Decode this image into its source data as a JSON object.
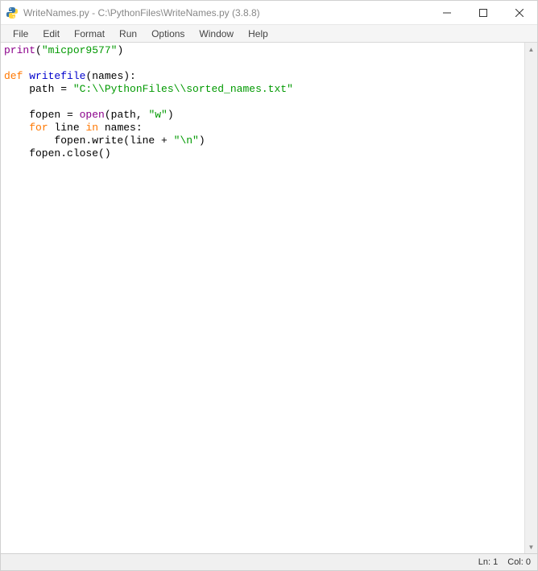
{
  "window": {
    "title": "WriteNames.py - C:\\PythonFiles\\WriteNames.py (3.8.8)"
  },
  "menu": {
    "items": [
      "File",
      "Edit",
      "Format",
      "Run",
      "Options",
      "Window",
      "Help"
    ]
  },
  "code": {
    "line1_print": "print",
    "line1_paren_open": "(",
    "line1_str": "\"micpor9577\"",
    "line1_paren_close": ")",
    "line3_def": "def",
    "line3_space": " ",
    "line3_fn": "writefile",
    "line3_params": "(names):",
    "line4_indent": "    path = ",
    "line4_str": "\"C:\\\\PythonFiles\\\\sorted_names.txt\"",
    "line6_indent": "    fopen = ",
    "line6_open": "open",
    "line6_args_open": "(path, ",
    "line6_mode": "\"w\"",
    "line6_args_close": ")",
    "line7_indent": "    ",
    "line7_for": "for",
    "line7_mid": " line ",
    "line7_in": "in",
    "line7_rest": " names:",
    "line8_indent": "        fopen.write(line + ",
    "line8_str": "\"\\n\"",
    "line8_close": ")",
    "line9": "    fopen.close()"
  },
  "status": {
    "line": "Ln: 1",
    "col": "Col: 0"
  }
}
